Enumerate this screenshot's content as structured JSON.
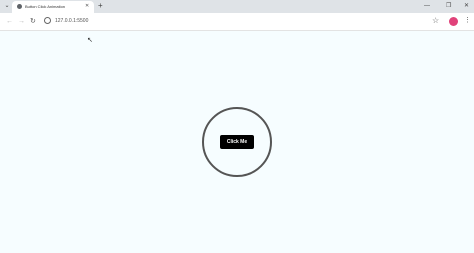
{
  "browser": {
    "tab": {
      "title": "Button Click Animation"
    },
    "address_bar": {
      "url": "127.0.0.1:5500"
    },
    "icons": {
      "tab_menu": "chevron-down-icon",
      "favicon": "globe-icon",
      "tab_close": "close-icon",
      "new_tab": "plus-icon",
      "back": "arrow-left-icon",
      "forward": "arrow-right-icon",
      "reload": "reload-icon",
      "site_info": "info-icon",
      "bookmark": "star-icon",
      "profile": "avatar",
      "menu": "kebab-icon"
    },
    "profile_color": "#e0427a"
  },
  "page": {
    "button_label": "Click Me",
    "background_color": "#f6fdff",
    "button_color": "#000000",
    "ring_color": "#555555"
  }
}
